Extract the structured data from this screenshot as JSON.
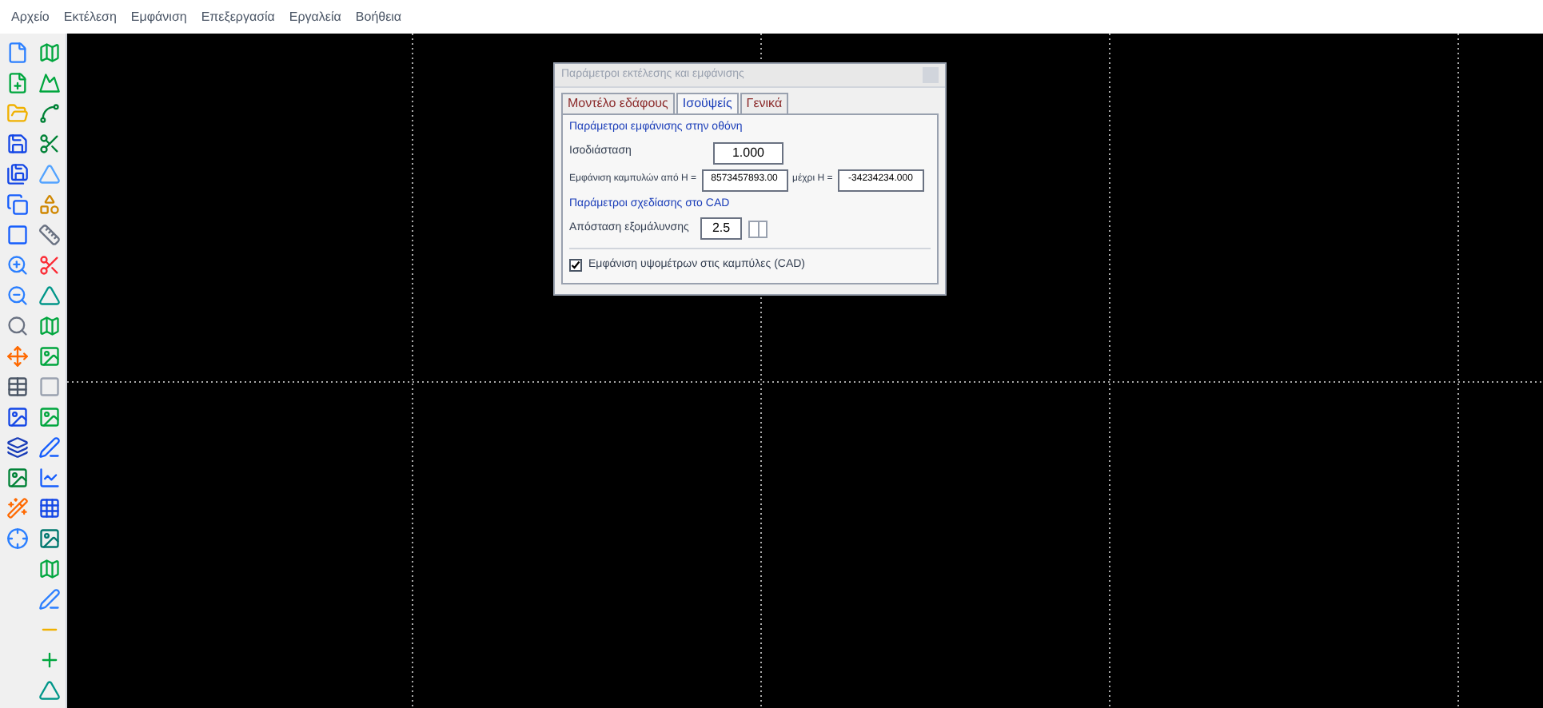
{
  "menu": [
    "Αρχείο",
    "Εκτέλεση",
    "Εμφάνιση",
    "Επεξεργασία",
    "Εργαλεία",
    "Βοήθεια"
  ],
  "dialog": {
    "title": "Παράμετροι εκτέλεσης και εμφάνισης",
    "tabs": [
      {
        "label": "Μοντέλο εδάφους",
        "selected": false
      },
      {
        "label": "Ισοϋψείς",
        "selected": true
      },
      {
        "label": "Γενικά",
        "selected": false
      }
    ],
    "screen_section": {
      "heading": "Παράμετροι εμφάνισης στην οθόνη",
      "interval_label": "Ισοδιάσταση",
      "interval_value": "1.000",
      "range_label": "Εμφάνιση καμπυλών από Η =",
      "from_value": "8573457893.00",
      "to_label": "μέχρι Η =",
      "to_value": "-34234234.000"
    },
    "cad_section": {
      "heading": "Παράμετροι σχεδίασης στο CAD",
      "smoothing_label": "Απόσταση εξομάλυνσης",
      "smoothing_value": "2.5"
    },
    "checkbox": {
      "label": "Εμφάνιση υψομέτρων στις καμπύλες (CAD)",
      "checked": true
    }
  }
}
